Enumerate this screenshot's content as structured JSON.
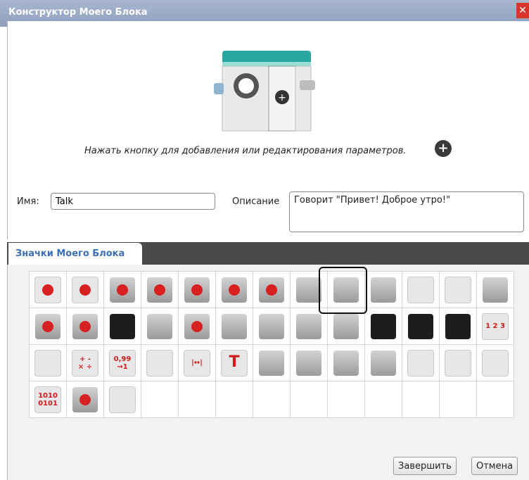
{
  "window": {
    "title": "Конструктор Моего Блока",
    "close_glyph": "✕"
  },
  "editor": {
    "hint": "Нажать кнопку для добавления или редактирования параметров.",
    "name_label": "Имя:",
    "name_value": "Talk",
    "description_label": "Описание",
    "description_value": "Говорит \"Привет! Доброе утро!\""
  },
  "icons_tab": {
    "label": "Значки Моего Блока"
  },
  "icons": [
    "brain-gears-red",
    "brain-gears-dark",
    "large-motor-grey",
    "medium-motor-red",
    "motor-pair-red",
    "motor-steering",
    "motor-tank",
    "brick-buttons",
    "sound-speaker-selected",
    "display",
    "timer-hourglass",
    "loop-interrupt",
    "sensor-block",
    "color-sensor",
    "gyro-sensor",
    "infrared-sensor",
    "infrared-beacon",
    "motor-rotation",
    "timer-stopwatch",
    "touch-sensor",
    "ultrasonic-sensor",
    "energy-meter",
    "nxt-sound",
    "case-open",
    "case-locked",
    "sequence-123",
    "logic",
    "math",
    "round",
    "compare",
    "range",
    "text",
    "random",
    "file-access",
    "data-logging",
    "messaging",
    "bluetooth",
    "bluetooth-settings",
    "no-sleep",
    "binary",
    "motor-invert",
    "raw-sensor"
  ],
  "icon_texts": {
    "math": "+ -\n× ÷",
    "round": "0,99\n→1",
    "text": "T",
    "binary": "1010\n0101",
    "sequence-123": "1 2 3",
    "range": "|↔|"
  },
  "buttons": {
    "finish": "Завершить",
    "cancel": "Отмена"
  }
}
